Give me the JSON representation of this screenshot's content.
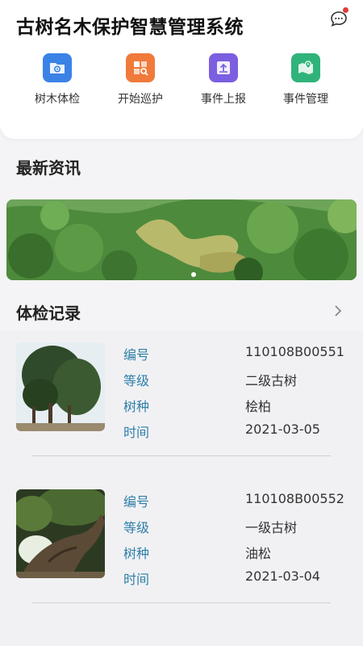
{
  "header": {
    "title": "古树名木保护智慧管理系统",
    "message_icon": "chat-bubble-icon"
  },
  "quick_actions": [
    {
      "label": "树木体检",
      "icon": "folder-gear-icon",
      "color": "#3b82e6"
    },
    {
      "label": "开始巡护",
      "icon": "search-grid-icon",
      "color": "#f07a3a"
    },
    {
      "label": "事件上报",
      "icon": "upload-tray-icon",
      "color": "#7b5fe0"
    },
    {
      "label": "事件管理",
      "icon": "map-pin-icon",
      "color": "#2fb37a"
    }
  ],
  "news": {
    "title": "最新资讯"
  },
  "records": {
    "title": "体检记录",
    "items": [
      {
        "fields": [
          {
            "key": "编号",
            "value": "110108B00551"
          },
          {
            "key": "等级",
            "value": "二级古树"
          },
          {
            "key": "树种",
            "value": "桧柏"
          },
          {
            "key": "时间",
            "value": "2021-03-05"
          }
        ]
      },
      {
        "fields": [
          {
            "key": "编号",
            "value": "110108B00552"
          },
          {
            "key": "等级",
            "value": "一级古树"
          },
          {
            "key": "树种",
            "value": "油松"
          },
          {
            "key": "时间",
            "value": "2021-03-04"
          }
        ]
      }
    ]
  },
  "colors": {
    "field_key": "#2f7fa8",
    "accent_red": "#e23b3b"
  }
}
